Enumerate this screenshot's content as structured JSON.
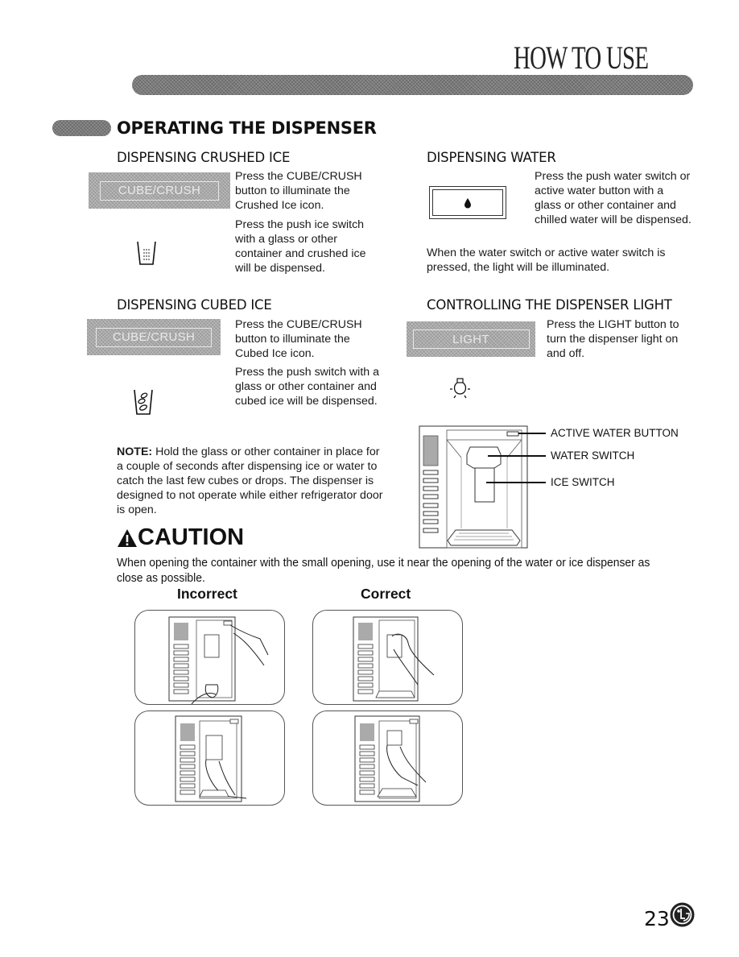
{
  "header": {
    "title": "HOW TO USE"
  },
  "section": {
    "title": "OPERATING THE DISPENSER"
  },
  "crushed_ice": {
    "title": "DISPENSING CRUSHED ICE",
    "button_label": "CUBE/CRUSH",
    "text1": "Press the CUBE/CRUSH button to illuminate the Crushed Ice icon.",
    "text2": "Press the push ice switch with a glass or other container and crushed ice will be dispensed.",
    "icon": "crushed-ice-glass-icon"
  },
  "water": {
    "title": "DISPENSING WATER",
    "icon": "water-drop-icon",
    "text1": "Press the push water switch or active water button with a glass or other container and chilled water will be dispensed.",
    "text2": "When the water switch or active water switch is pressed, the light will be illuminated."
  },
  "cubed_ice": {
    "title": "DISPENSING CUBED ICE",
    "button_label": "CUBE/CRUSH",
    "text1": "Press the CUBE/CRUSH button to illuminate the Cubed Ice icon.",
    "text2": "Press the push switch with a glass or other container and cubed ice will be dispensed.",
    "icon": "cubed-ice-glass-icon"
  },
  "light": {
    "title": "CONTROLLING THE DISPENSER LIGHT",
    "button_label": "LIGHT",
    "text1": "Press the LIGHT button to turn the dispenser light on and off.",
    "icon": "light-bulb-icon"
  },
  "diagram": {
    "labels": [
      "ACTIVE WATER BUTTON",
      "WATER SWITCH",
      "ICE SWITCH"
    ]
  },
  "note": {
    "label": "NOTE:",
    "text": " Hold the glass or other container in place for a couple of seconds after dispensing ice or water to catch the last few cubes or drops. The dispenser is designed to not operate while either refrigerator door is open."
  },
  "caution": {
    "title": "CAUTION",
    "text": "When opening the container with the small opening, use it near the opening of the water or ice dispenser as close as possible.",
    "incorrect_label": "Incorrect",
    "correct_label": "Correct"
  },
  "footer": {
    "page_number": "23",
    "logo": "LG"
  }
}
